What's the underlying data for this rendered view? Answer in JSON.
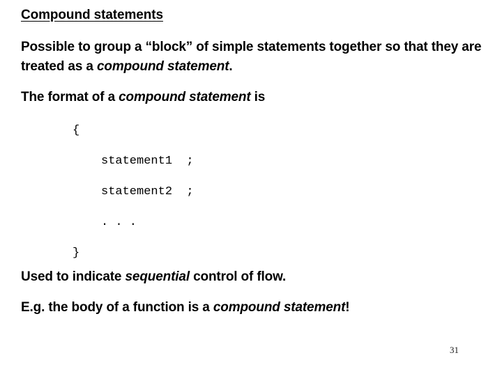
{
  "slide": {
    "title": "Compound statements",
    "page_number": "31",
    "paragraphs": {
      "intro": {
        "part1": "Possible to group a “block” of simple statements together so that they are treated as a ",
        "emphasis": "compound statement",
        "part2": "."
      },
      "format": {
        "part1": "The format of a ",
        "emphasis": "compound statement",
        "part2": " is"
      },
      "used": {
        "part1": "Used to indicate ",
        "emphasis": "sequential",
        "part2": " control of flow."
      },
      "eg": {
        "part1": "E.g. the body of a function is a ",
        "emphasis": "compound statement",
        "part2": "!"
      }
    },
    "code_block": {
      "lines": [
        {
          "text": "{",
          "indent": "brace"
        },
        {
          "text": "statement1  ;",
          "indent": "stmt"
        },
        {
          "text": "statement2  ;",
          "indent": "stmt"
        },
        {
          "text": ". . .",
          "indent": "stmt"
        },
        {
          "text": "}",
          "indent": "brace"
        }
      ],
      "line_0": "{",
      "line_1": "statement1  ;",
      "line_2": "statement2  ;",
      "line_3": ". . .",
      "line_4": "}"
    }
  }
}
